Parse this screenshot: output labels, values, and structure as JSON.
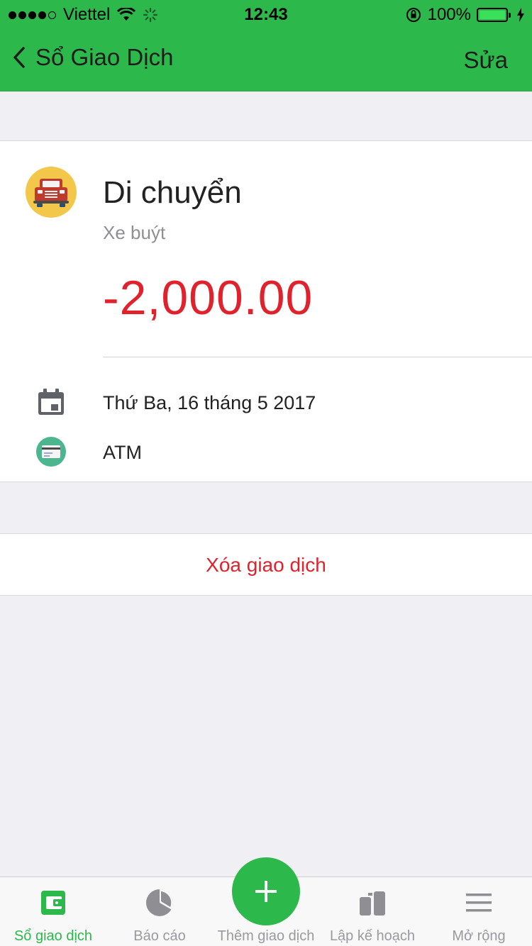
{
  "status": {
    "carrier": "Viettel",
    "time": "12:43",
    "battery": "100%"
  },
  "nav": {
    "back_label": "Sổ Giao Dịch",
    "edit_label": "Sửa"
  },
  "transaction": {
    "category": "Di chuyển",
    "note": "Xe buýt",
    "amount": "-2,000.00",
    "date": "Thứ Ba, 16 tháng 5 2017",
    "wallet": "ATM"
  },
  "actions": {
    "delete_label": "Xóa giao dịch"
  },
  "tabs": [
    {
      "label": "Sổ giao dịch",
      "icon": "wallet-icon",
      "active": true
    },
    {
      "label": "Báo cáo",
      "icon": "pie-chart-icon",
      "active": false
    },
    {
      "label": "Thêm giao dịch",
      "icon": "plus-icon",
      "active": false
    },
    {
      "label": "Lập kế hoạch",
      "icon": "planning-icon",
      "active": false
    },
    {
      "label": "Mở rộng",
      "icon": "menu-icon",
      "active": false
    }
  ],
  "colors": {
    "brand_green": "#2db84c",
    "expense_red": "#e0222d",
    "category_icon_bg": "#f3c74a",
    "wallet_icon_bg": "#4db58f"
  }
}
